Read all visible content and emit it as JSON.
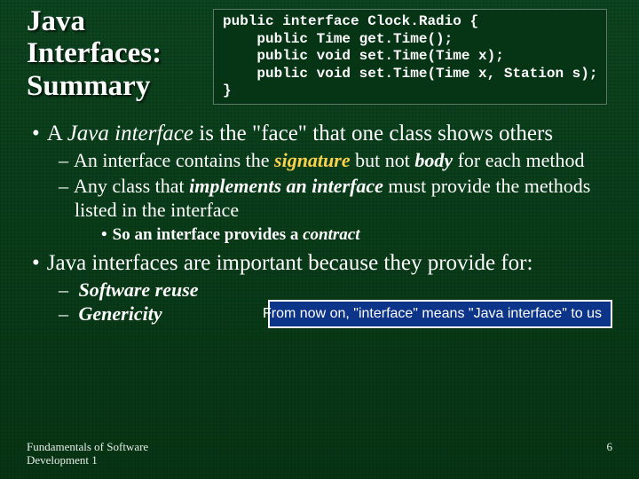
{
  "title_lines": [
    "Java",
    "Interfaces:",
    "Summary"
  ],
  "code": {
    "l1": "public interface Clock.Radio {",
    "l2": "    public Time get.Time();",
    "l3": "    public void set.Time(Time x);",
    "l4": "    public void set.Time(Time x, Station s);",
    "l5": "}"
  },
  "b1a": {
    "pre": "A ",
    "term": "Java interface",
    "post": " is the \"face\" that one class shows others"
  },
  "b2a": {
    "pre": "An interface contains the ",
    "sig": "signature",
    "mid": " but not ",
    "body_word": "body",
    "post": " for each method"
  },
  "b2b": {
    "pre": "Any class that ",
    "impl": "implements an interface",
    "post": " must provide the methods listed in the interface"
  },
  "b3a": {
    "pre": "So an interface provides a ",
    "term": "contract"
  },
  "b1b": {
    "text": "Java interfaces are important because they provide for:"
  },
  "b2c": {
    "term": "Software reuse"
  },
  "b2d": {
    "term": "Genericity"
  },
  "callout": "From now on, \"interface\" means \"Java interface\" to us",
  "footer_left_1": "Fundamentals of Software",
  "footer_left_2": "Development 1",
  "page_num": "6"
}
